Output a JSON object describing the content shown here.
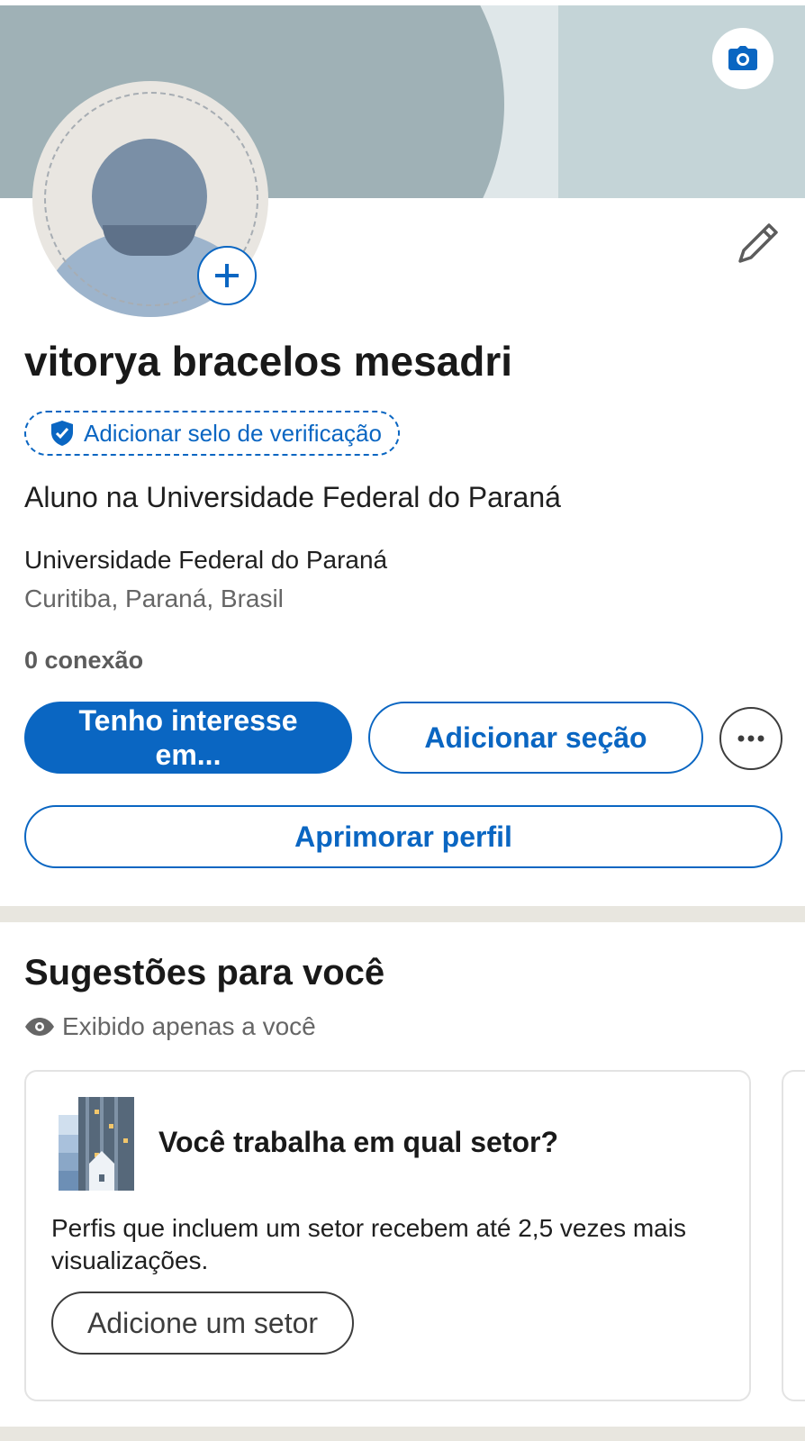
{
  "profile": {
    "name": "vitorya bracelos mesadri",
    "verify_label": "Adicionar selo de verificação",
    "headline": "Aluno na Universidade Federal do Paraná",
    "school": "Universidade Federal do Paraná",
    "location": "Curitiba, Paraná, Brasil",
    "connections": "0 conexão"
  },
  "actions": {
    "interest_label": "Tenho interesse em...",
    "add_section_label": "Adicionar seção",
    "improve_label": "Aprimorar perfil"
  },
  "suggestions": {
    "title": "Sugestões para você",
    "visibility": "Exibido apenas a você",
    "card": {
      "title": "Você trabalha em qual setor?",
      "text": "Perfis que incluem um setor recebem até 2,5 vezes mais visualizações.",
      "button_label": "Adicione um setor"
    }
  },
  "colors": {
    "accent": "#0a66c2",
    "cover": "#9fb1b6",
    "divider": "#e8e6df"
  },
  "icons": [
    "camera-icon",
    "plus-icon",
    "pencil-icon",
    "shield-check-icon",
    "more-icon",
    "eye-icon",
    "industry-illustration"
  ]
}
